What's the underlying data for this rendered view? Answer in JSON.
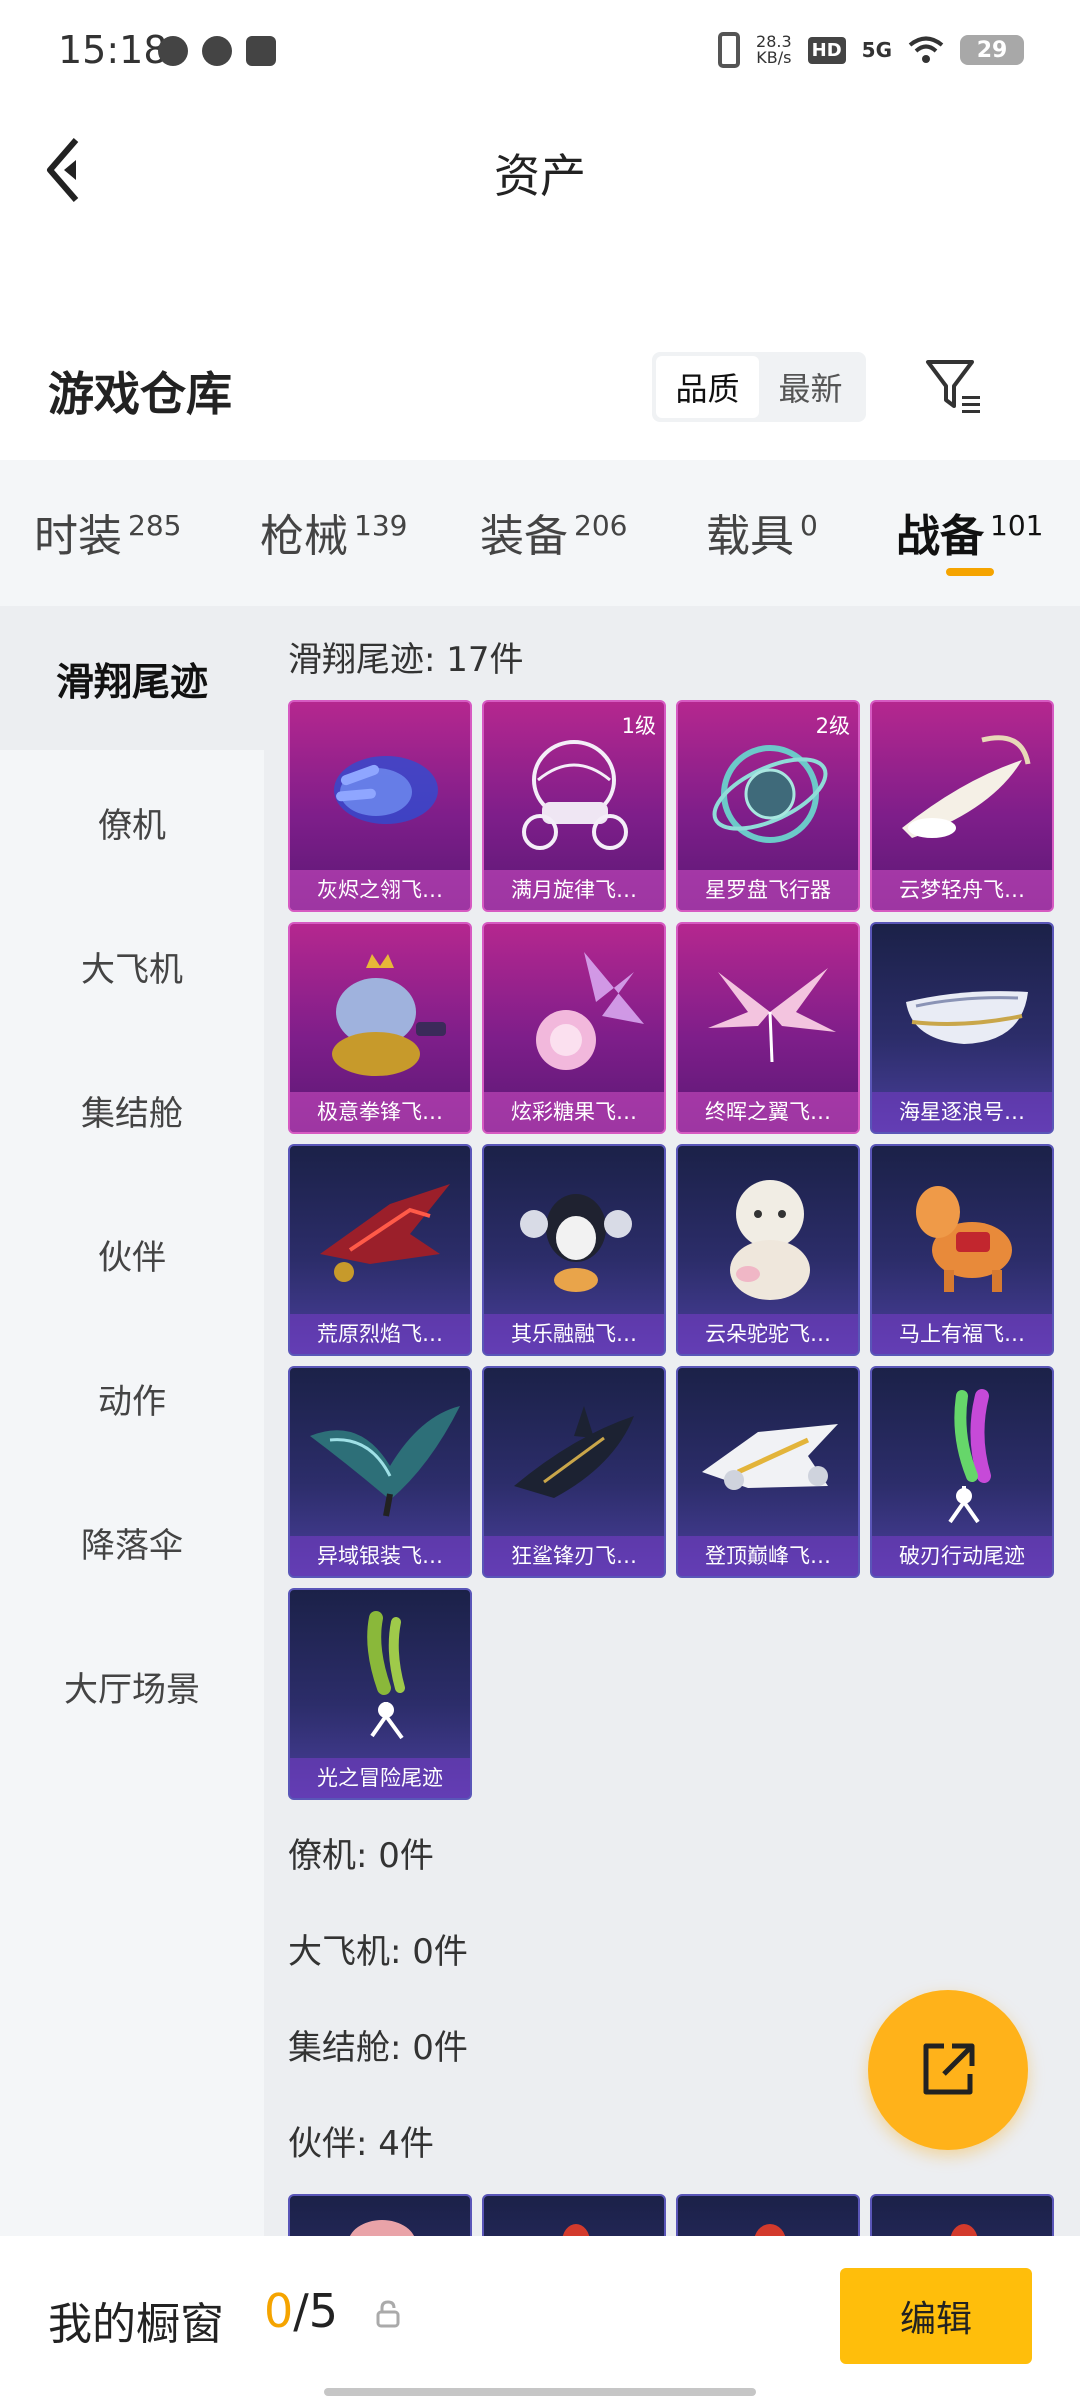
{
  "status_bar": {
    "time": "15:18",
    "net_speed_value": "28.3",
    "net_speed_unit": "KB/s",
    "hd": "HD",
    "network": "5G",
    "battery": "29"
  },
  "header": {
    "title": "资产"
  },
  "warehouse": {
    "title": "游戏仓库",
    "sort_options": [
      "品质",
      "最新"
    ],
    "sort_selected": "品质"
  },
  "category_tabs": [
    {
      "label": "时装",
      "count": "285"
    },
    {
      "label": "枪械",
      "count": "139"
    },
    {
      "label": "装备",
      "count": "206"
    },
    {
      "label": "载具",
      "count": "0"
    },
    {
      "label": "战备",
      "count": "101",
      "active": true
    }
  ],
  "side_nav": [
    {
      "label": "滑翔尾迹",
      "active": true
    },
    {
      "label": "僚机"
    },
    {
      "label": "大飞机"
    },
    {
      "label": "集结舱"
    },
    {
      "label": "伙伴"
    },
    {
      "label": "动作"
    },
    {
      "label": "降落伞"
    },
    {
      "label": "大厅场景"
    }
  ],
  "sections": {
    "glide_title": "滑翔尾迹: 17件",
    "items": [
      {
        "name": "灰烬之翎飞…",
        "rarity": "pink",
        "icon": "glove-icon"
      },
      {
        "name": "满月旋律飞…",
        "rarity": "pink",
        "level": "1级",
        "icon": "carriage-icon"
      },
      {
        "name": "星罗盘飞行器",
        "rarity": "pink",
        "level": "2级",
        "icon": "astrolabe-icon"
      },
      {
        "name": "云梦轻舟飞…",
        "rarity": "pink",
        "icon": "cloud-boat-icon"
      },
      {
        "name": "极意拳锋飞…",
        "rarity": "pink",
        "icon": "elephant-icon"
      },
      {
        "name": "炫彩糖果飞…",
        "rarity": "pink",
        "icon": "candy-icon"
      },
      {
        "name": "终晖之翼飞…",
        "rarity": "pink",
        "icon": "wings-icon"
      },
      {
        "name": "海星逐浪号…",
        "rarity": "blue",
        "icon": "boat-icon"
      },
      {
        "name": "荒原烈焰飞…",
        "rarity": "blue",
        "icon": "flame-glider-icon"
      },
      {
        "name": "其乐融融飞…",
        "rarity": "blue",
        "icon": "penguin-icon"
      },
      {
        "name": "云朵驼驼飞…",
        "rarity": "blue",
        "icon": "alpaca-icon"
      },
      {
        "name": "马上有福飞…",
        "rarity": "blue",
        "icon": "horse-icon"
      },
      {
        "name": "异域银装飞…",
        "rarity": "blue",
        "icon": "silver-glider-icon"
      },
      {
        "name": "狂鲨锋刃飞…",
        "rarity": "blue",
        "icon": "shark-icon"
      },
      {
        "name": "登顶巅峰飞…",
        "rarity": "blue",
        "icon": "jet-icon"
      },
      {
        "name": "破刃行动尾迹",
        "rarity": "blue",
        "icon": "smoke-trail-icon"
      },
      {
        "name": "光之冒险尾迹",
        "rarity": "blue",
        "icon": "green-trail-icon"
      }
    ],
    "summaries": [
      "僚机: 0件",
      "大飞机: 0件",
      "集结舱: 0件",
      "伙伴: 4件"
    ]
  },
  "bottom_bar": {
    "label": "我的橱窗",
    "current": "0",
    "total": "/5",
    "edit_label": "编辑"
  }
}
